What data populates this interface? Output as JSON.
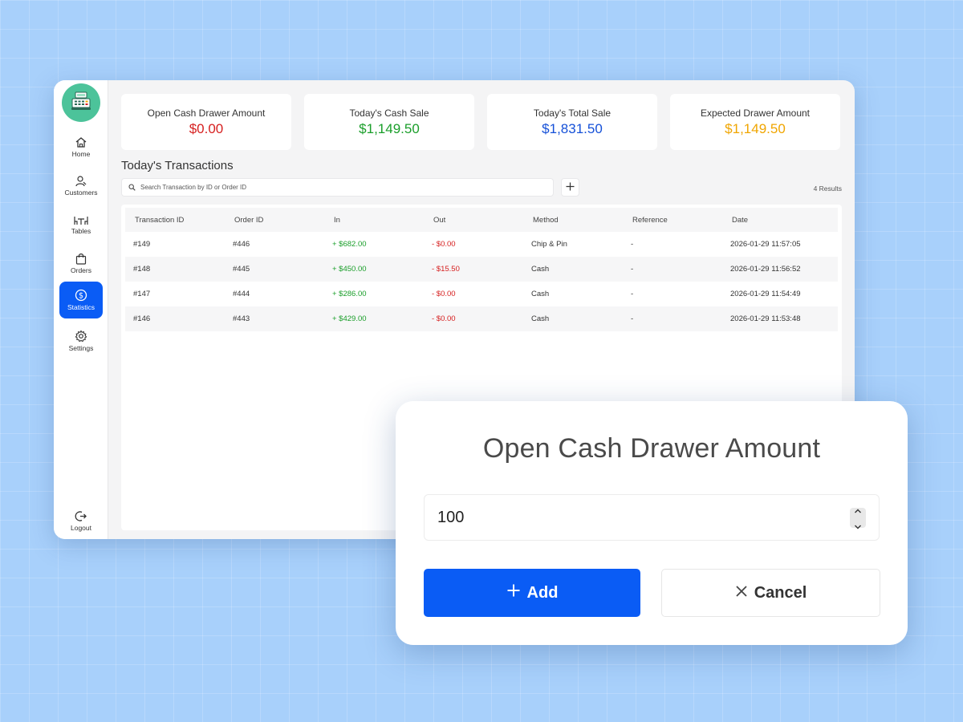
{
  "sidebar": {
    "logo_icon": "cash-register-icon",
    "items": [
      {
        "label": "Home",
        "icon": "home-icon"
      },
      {
        "label": "Customers",
        "icon": "customers-icon"
      },
      {
        "label": "Tables",
        "icon": "tables-icon"
      },
      {
        "label": "Orders",
        "icon": "shopping-bag-icon"
      },
      {
        "label": "Statistics",
        "icon": "dollar-circle-icon",
        "active": true
      },
      {
        "label": "Settings",
        "icon": "gear-icon"
      }
    ],
    "logout": {
      "label": "Logout",
      "icon": "logout-icon"
    }
  },
  "stats": [
    {
      "title": "Open Cash Drawer Amount",
      "value": "$0.00",
      "color": "#d62020"
    },
    {
      "title": "Today's Cash Sale",
      "value": "$1,149.50",
      "color": "#1a9e2a"
    },
    {
      "title": "Today's Total Sale",
      "value": "$1,831.50",
      "color": "#1550d8"
    },
    {
      "title": "Expected Drawer Amount",
      "value": "$1,149.50",
      "color": "#f0a500"
    }
  ],
  "transactions": {
    "title": "Today's Transactions",
    "search_placeholder": "Search Transaction by ID or Order ID",
    "results": "4 Results",
    "columns": [
      "Transaction ID",
      "Order ID",
      "In",
      "Out",
      "Method",
      "Reference",
      "Date"
    ],
    "rows": [
      {
        "id": "#149",
        "order": "#446",
        "in": "+ $682.00",
        "out": "- $0.00",
        "method": "Chip & Pin",
        "reference": "-",
        "date": "2026-01-29 11:57:05"
      },
      {
        "id": "#148",
        "order": "#445",
        "in": "+ $450.00",
        "out": "- $15.50",
        "method": "Cash",
        "reference": "-",
        "date": "2026-01-29 11:56:52"
      },
      {
        "id": "#147",
        "order": "#444",
        "in": "+ $286.00",
        "out": "- $0.00",
        "method": "Cash",
        "reference": "-",
        "date": "2026-01-29 11:54:49"
      },
      {
        "id": "#146",
        "order": "#443",
        "in": "+ $429.00",
        "out": "- $0.00",
        "method": "Cash",
        "reference": "-",
        "date": "2026-01-29 11:53:48"
      }
    ]
  },
  "modal": {
    "title": "Open Cash Drawer Amount",
    "amount_value": "100",
    "add_label": "Add",
    "cancel_label": "Cancel"
  },
  "colors": {
    "accent": "#0a5cf5",
    "logo": "#4cc39a",
    "in": "#1a9e2a",
    "out": "#d62020"
  }
}
